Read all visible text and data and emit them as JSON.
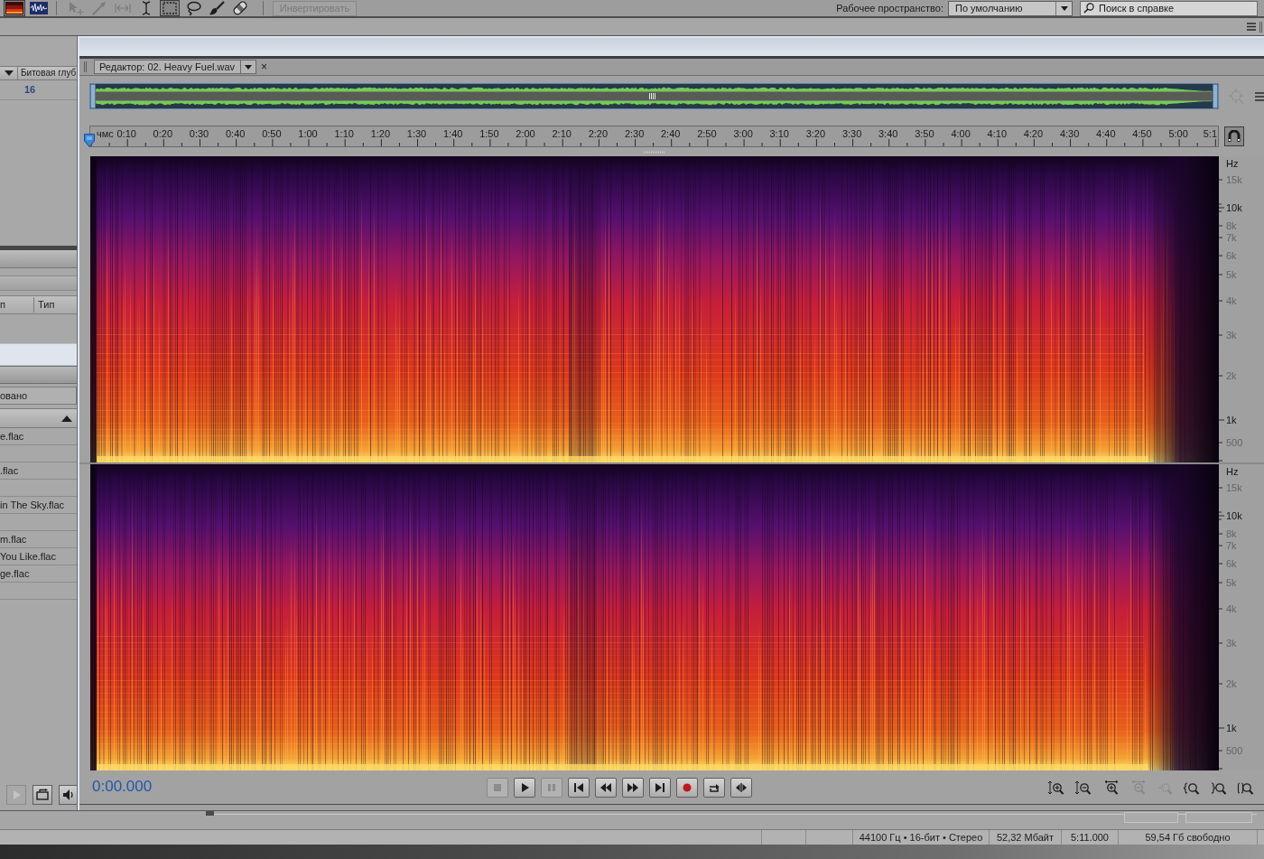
{
  "toolbar": {
    "view_buttons": [
      {
        "kind": "spectral",
        "selected": true
      },
      {
        "kind": "waveform",
        "selected": false
      }
    ],
    "tools": [
      {
        "kind": "move",
        "disabled": true,
        "selected": false
      },
      {
        "kind": "razor",
        "disabled": true,
        "selected": false
      },
      {
        "kind": "slip",
        "disabled": true,
        "selected": false
      },
      {
        "kind": "time_selection",
        "disabled": false,
        "selected": false
      },
      {
        "kind": "marquee",
        "disabled": false,
        "selected": true
      },
      {
        "kind": "lasso",
        "disabled": false,
        "selected": false
      },
      {
        "kind": "brush",
        "disabled": false,
        "selected": false
      },
      {
        "kind": "healing",
        "disabled": false,
        "selected": false
      }
    ],
    "invert_button": {
      "label": "Инвертировать",
      "disabled": true
    },
    "workspace": {
      "label": "Рабочее пространство:",
      "value": "По умолчанию"
    },
    "help_search": {
      "placeholder": "Поиск в справке"
    }
  },
  "left_panel": {
    "bit_depth": {
      "header": "Битовая глуб",
      "value": "16"
    },
    "columns": [
      "п",
      "Тип"
    ],
    "rows": [
      {
        "selected": true
      }
    ],
    "filter": "овано",
    "files": [
      "e.flac",
      ".flac",
      "in The Sky.flac",
      "m.flac",
      "You Like.flac",
      "ge.flac"
    ],
    "buttons": [
      {
        "kind": "play",
        "disabled": true
      },
      {
        "kind": "loop",
        "disabled": false
      },
      {
        "kind": "autoplay",
        "disabled": false
      }
    ]
  },
  "editor": {
    "tab": {
      "label": "Редактор: 02. Heavy Fuel.wav",
      "close": "×"
    },
    "ruler": {
      "labels": [
        "чмс",
        "0:10",
        "0:20",
        "0:30",
        "0:40",
        "0:50",
        "1:00",
        "1:10",
        "1:20",
        "1:30",
        "1:40",
        "1:50",
        "2:00",
        "2:10",
        "2:20",
        "2:30",
        "2:40",
        "2:50",
        "3:00",
        "3:10",
        "3:20",
        "3:30",
        "3:40",
        "3:50",
        "4:00",
        "4:10",
        "4:20",
        "4:30",
        "4:40",
        "4:50",
        "5:00",
        "5:1"
      ]
    },
    "channels": [
      {
        "unit": "Hz",
        "frequency_labels": [
          {
            "text": "15k",
            "major": false
          },
          {
            "text": "10k",
            "major": true
          },
          {
            "text": "8k",
            "major": false
          },
          {
            "text": "7k",
            "major": false
          },
          {
            "text": "6k",
            "major": false
          },
          {
            "text": "5k",
            "major": false
          },
          {
            "text": "4k",
            "major": false
          },
          {
            "text": "3k",
            "major": false
          },
          {
            "text": "2k",
            "major": false
          },
          {
            "text": "1k",
            "major": true
          },
          {
            "text": "500",
            "major": false
          }
        ]
      },
      {
        "unit": "Hz",
        "frequency_labels": [
          {
            "text": "15k",
            "major": false
          },
          {
            "text": "10k",
            "major": true
          },
          {
            "text": "8k",
            "major": false
          },
          {
            "text": "7k",
            "major": false
          },
          {
            "text": "6k",
            "major": false
          },
          {
            "text": "5k",
            "major": false
          },
          {
            "text": "4k",
            "major": false
          },
          {
            "text": "3k",
            "major": false
          },
          {
            "text": "2k",
            "major": false
          },
          {
            "text": "1k",
            "major": true
          },
          {
            "text": "500",
            "major": false
          }
        ]
      }
    ],
    "time": "0:00.000",
    "transport_buttons": [
      {
        "kind": "stop",
        "disabled": true
      },
      {
        "kind": "play",
        "disabled": false
      },
      {
        "kind": "pause",
        "disabled": true
      },
      {
        "kind": "to_start",
        "disabled": false
      },
      {
        "kind": "rewind",
        "disabled": false
      },
      {
        "kind": "forward",
        "disabled": false
      },
      {
        "kind": "to_end",
        "disabled": false
      },
      {
        "kind": "record",
        "disabled": false
      },
      {
        "kind": "loop",
        "disabled": false
      },
      {
        "kind": "skip",
        "disabled": false
      }
    ],
    "zoom_buttons": [
      {
        "kind": "amplitude_in",
        "disabled": false
      },
      {
        "kind": "amplitude_out",
        "disabled": false
      },
      {
        "kind": "time_in",
        "disabled": false
      },
      {
        "kind": "time_out",
        "disabled": true
      },
      {
        "kind": "selection",
        "disabled": true
      },
      {
        "kind": "in_start",
        "disabled": false
      },
      {
        "kind": "in_end",
        "disabled": false
      },
      {
        "kind": "out_both",
        "disabled": false
      }
    ]
  },
  "status_bar": [
    "44100 Гц • 16-бит • Стерео",
    "52,32 Мбайт",
    "5:11.000",
    "59,54 Гб свободно"
  ]
}
